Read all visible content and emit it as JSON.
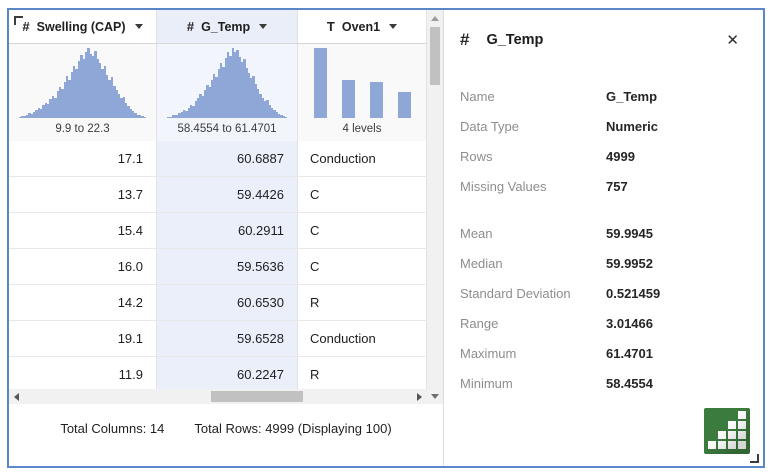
{
  "table": {
    "selected_col": 1,
    "columns": [
      {
        "field": "swelling-cap",
        "type_glyph": "#",
        "icon_name": "numeric-type-icon",
        "label": "Swelling (CAP)",
        "range_label": "9.9 to 22.3",
        "align": "right",
        "spark_style": "histogram",
        "spark": [
          2,
          3,
          3,
          5,
          7,
          6,
          9,
          12,
          15,
          13,
          18,
          22,
          20,
          27,
          32,
          29,
          38,
          45,
          41,
          52,
          60,
          55,
          66,
          74,
          70,
          82,
          90,
          84,
          95,
          100,
          92,
          88,
          96,
          85,
          78,
          70,
          74,
          62,
          55,
          58,
          46,
          40,
          34,
          28,
          30,
          22,
          17,
          13,
          10,
          7,
          5,
          4,
          3,
          2
        ]
      },
      {
        "field": "g-temp",
        "type_glyph": "#",
        "icon_name": "numeric-type-icon",
        "label": "G_Temp",
        "range_label": "58.4554 to 61.4701",
        "align": "right",
        "spark_style": "histogram",
        "spark": [
          2,
          2,
          4,
          5,
          4,
          7,
          9,
          12,
          10,
          15,
          19,
          17,
          24,
          29,
          34,
          31,
          40,
          47,
          44,
          55,
          63,
          58,
          70,
          79,
          73,
          86,
          95,
          89,
          100,
          94,
          97,
          87,
          80,
          84,
          72,
          64,
          57,
          60,
          48,
          41,
          35,
          29,
          24,
          26,
          18,
          14,
          11,
          8,
          6,
          4,
          3,
          2
        ]
      },
      {
        "field": "oven1",
        "type_glyph": "T",
        "icon_name": "text-type-icon",
        "label": "Oven1",
        "range_label": "4 levels",
        "align": "left",
        "spark_style": "bars",
        "spark": [
          100,
          55,
          52,
          37
        ]
      }
    ],
    "rows": [
      [
        "17.1",
        "60.6887",
        "Conduction"
      ],
      [
        "13.7",
        "59.4426",
        "C"
      ],
      [
        "15.4",
        "60.2911",
        "C"
      ],
      [
        "16.0",
        "59.5636",
        "C"
      ],
      [
        "14.2",
        "60.6530",
        "R"
      ],
      [
        "19.1",
        "59.6528",
        "Conduction"
      ],
      [
        "11.9",
        "60.2247",
        "R"
      ]
    ],
    "status": {
      "total_columns": "Total Columns: 14",
      "total_rows": "Total Rows: 4999 (Displaying 100)"
    }
  },
  "panel": {
    "type_glyph": "#",
    "title": "G_Temp",
    "close_glyph": "✕",
    "fields": [
      {
        "label": "Name",
        "value": "G_Temp"
      },
      {
        "label": "Data Type",
        "value": "Numeric"
      },
      {
        "label": "Rows",
        "value": "4999"
      },
      {
        "label": "Missing Values",
        "value": "757"
      },
      {
        "label": "Mean",
        "value": "59.9945",
        "group_start": true
      },
      {
        "label": "Median",
        "value": "59.9952"
      },
      {
        "label": "Standard Deviation",
        "value": "0.521459"
      },
      {
        "label": "Range",
        "value": "3.01466"
      },
      {
        "label": "Maximum",
        "value": "61.4701"
      },
      {
        "label": "Minimum",
        "value": "58.4554"
      }
    ]
  },
  "colors": {
    "accent_border": "#5b87c9",
    "selected_column_tint": "#e9eef9",
    "sparkline": "#8ea7d6",
    "chart_button_green": "#3b7b3e"
  }
}
